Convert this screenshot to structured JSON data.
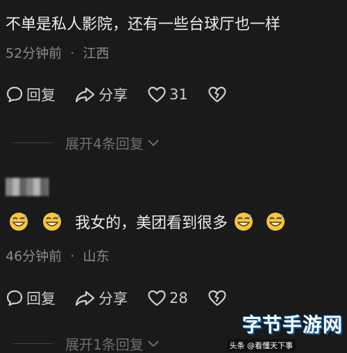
{
  "comment1": {
    "text": "不单是私人影院，还有一些台球厅也一样",
    "time": "52分钟前",
    "location": "江西",
    "reply_label": "回复",
    "share_label": "分享",
    "like_count": "31",
    "expand_label": "展开4条回复"
  },
  "comment2": {
    "text": "我女的，美团看到很多",
    "time": "46分钟前",
    "location": "山东",
    "reply_label": "回复",
    "share_label": "分享",
    "like_count": "28",
    "expand_label": "展开1条回复"
  },
  "meta_separator": "·",
  "watermark": {
    "brand": "字节手游网",
    "source": "头条 @看懂天下事"
  },
  "icons": {
    "reply": "speech-bubble-icon",
    "share": "share-arrow-icon",
    "like": "heart-icon",
    "dislike": "broken-heart-icon",
    "expand": "chevron-down-icon",
    "emoji": "grinning-sweat-emoji"
  },
  "colors": {
    "background": "#1a1a1a",
    "text": "#ededed",
    "meta": "#8c8c8c",
    "expand": "#6f6f6f"
  }
}
